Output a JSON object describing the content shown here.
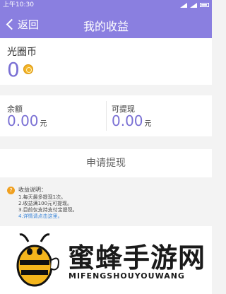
{
  "status_bar": {
    "time": "上午10:30"
  },
  "nav": {
    "back_label": "返回",
    "title": "我的收益"
  },
  "coins": {
    "label": "光圈币",
    "value": "0"
  },
  "balance": {
    "total_label": "余额",
    "total_value": "0.00",
    "total_unit": "元",
    "withdrawable_label": "可提现",
    "withdrawable_value": "0.00",
    "withdrawable_unit": "元"
  },
  "withdraw_button": "申请提现",
  "notes": {
    "title": "收益说明：",
    "lines": [
      "1.每天最多提现1次。",
      "2.收益满100元可提现。",
      "3.目前仅支持支付宝提现。"
    ],
    "link": "4.详情请点击这里。"
  },
  "watermark": {
    "cn": "蜜蜂手游网",
    "en": "MIFENGSHOUYOUWANG"
  },
  "colors": {
    "accent": "#8a7fe0",
    "value_purple": "#7a70d4",
    "coin": "#f3b427",
    "link": "#3a85d8"
  }
}
